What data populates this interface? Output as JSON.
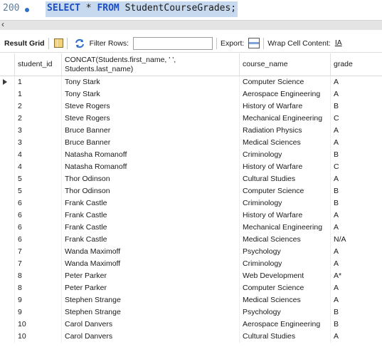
{
  "editor": {
    "line_number": "200",
    "sql_keyword1": "SELECT",
    "sql_star": " * ",
    "sql_keyword2": "FROM",
    "sql_rest": " StudentCourseGrades;"
  },
  "toolbar": {
    "result_grid_label": "Result Grid",
    "filter_rows_label": "Filter Rows:",
    "filter_value": "",
    "export_label": "Export:",
    "wrap_label": "Wrap Cell Content:",
    "wrap_icon_text": "IA"
  },
  "columns": {
    "student_id": "student_id",
    "concat_line1": "CONCAT(Students.first_name, ' ',",
    "concat_line2": "Students.last_name)",
    "course_name": "course_name",
    "grade": "grade"
  },
  "rows": [
    {
      "id": "1",
      "name": "Tony Stark",
      "course": "Computer Science",
      "grade": "A"
    },
    {
      "id": "1",
      "name": "Tony Stark",
      "course": "Aerospace Engineering",
      "grade": "A"
    },
    {
      "id": "2",
      "name": "Steve Rogers",
      "course": "History of Warfare",
      "grade": "B"
    },
    {
      "id": "2",
      "name": "Steve Rogers",
      "course": "Mechanical Engineering",
      "grade": "C"
    },
    {
      "id": "3",
      "name": "Bruce Banner",
      "course": "Radiation Physics",
      "grade": "A"
    },
    {
      "id": "3",
      "name": "Bruce Banner",
      "course": "Medical Sciences",
      "grade": "A"
    },
    {
      "id": "4",
      "name": "Natasha Romanoff",
      "course": "Criminology",
      "grade": "B"
    },
    {
      "id": "4",
      "name": "Natasha Romanoff",
      "course": "History of Warfare",
      "grade": "C"
    },
    {
      "id": "5",
      "name": "Thor Odinson",
      "course": "Cultural Studies",
      "grade": "A"
    },
    {
      "id": "5",
      "name": "Thor Odinson",
      "course": "Computer Science",
      "grade": "B"
    },
    {
      "id": "6",
      "name": "Frank Castle",
      "course": "Criminology",
      "grade": "B"
    },
    {
      "id": "6",
      "name": "Frank Castle",
      "course": "History of Warfare",
      "grade": "A"
    },
    {
      "id": "6",
      "name": "Frank Castle",
      "course": "Mechanical Engineering",
      "grade": "A"
    },
    {
      "id": "6",
      "name": "Frank Castle",
      "course": "Medical Sciences",
      "grade": "N/A"
    },
    {
      "id": "7",
      "name": "Wanda Maximoff",
      "course": "Psychology",
      "grade": "A"
    },
    {
      "id": "7",
      "name": "Wanda Maximoff",
      "course": "Criminology",
      "grade": "A"
    },
    {
      "id": "8",
      "name": "Peter Parker",
      "course": "Web Development",
      "grade": "A*"
    },
    {
      "id": "8",
      "name": "Peter Parker",
      "course": "Computer Science",
      "grade": "A"
    },
    {
      "id": "9",
      "name": "Stephen Strange",
      "course": "Medical Sciences",
      "grade": "A"
    },
    {
      "id": "9",
      "name": "Stephen Strange",
      "course": "Psychology",
      "grade": "B"
    },
    {
      "id": "10",
      "name": "Carol Danvers",
      "course": "Aerospace Engineering",
      "grade": "B"
    },
    {
      "id": "10",
      "name": "Carol Danvers",
      "course": "Cultural Studies",
      "grade": "A"
    }
  ]
}
